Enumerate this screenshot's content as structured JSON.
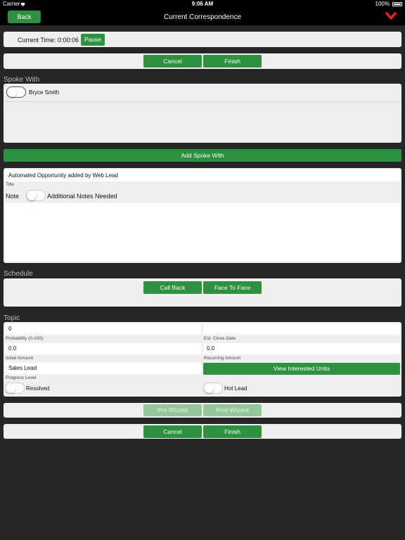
{
  "status_bar": {
    "carrier": "Carrier",
    "time": "9:06 AM",
    "battery": "100%"
  },
  "nav": {
    "back_label": "Back",
    "title": "Current Correspondence",
    "menu_icon": "chevron-down-icon"
  },
  "timer": {
    "label": "Current Time:",
    "value": "0:00:06",
    "pause_label": "Pause"
  },
  "top_actions": {
    "cancel": "Cancel",
    "finish": "Finish"
  },
  "spoke_with": {
    "section_label": "Spoke With",
    "contacts": [
      {
        "name": "Bryce Smith",
        "checked": false
      }
    ],
    "add_button": "Add Spoke With"
  },
  "note_card": {
    "opportunity_title": "Automated Opportunity added by Web Lead",
    "title_label": "Title",
    "note_label": "Note",
    "additional_notes_label": "Additional Notes Needed",
    "additional_notes_on": false,
    "note_text": ""
  },
  "schedule": {
    "section_label": "Schedule",
    "call_back": "Call Back",
    "face_to_face": "Face To Face"
  },
  "topic": {
    "section_label": "Topic",
    "topic_value": "0",
    "topic_value_2": "",
    "probability_label": "Probability (0-100)",
    "probability_value": "0.0",
    "close_date_label": "Est. Close Date",
    "close_date_value": "0.0",
    "initial_amount_label": "Initial Amount",
    "initial_amount_value": "Sales Lead",
    "recurring_amount_label": "Recurring Amount",
    "view_units_button": "View Interested Units",
    "progress_level_label": "Progress Level",
    "resolved_label": "Resolved",
    "resolved_on": false,
    "hot_lead_label": "Hot Lead",
    "hot_lead_on": false
  },
  "wizard": {
    "pre": "Pre-Wizard",
    "post": "Post-Wizard"
  },
  "bottom_actions": {
    "cancel": "Cancel",
    "finish": "Finish"
  },
  "colors": {
    "accent": "#2e9140",
    "accent_disabled": "#93c79b",
    "background": "#262626",
    "panel": "#efefef",
    "chevron": "#e8222a"
  }
}
